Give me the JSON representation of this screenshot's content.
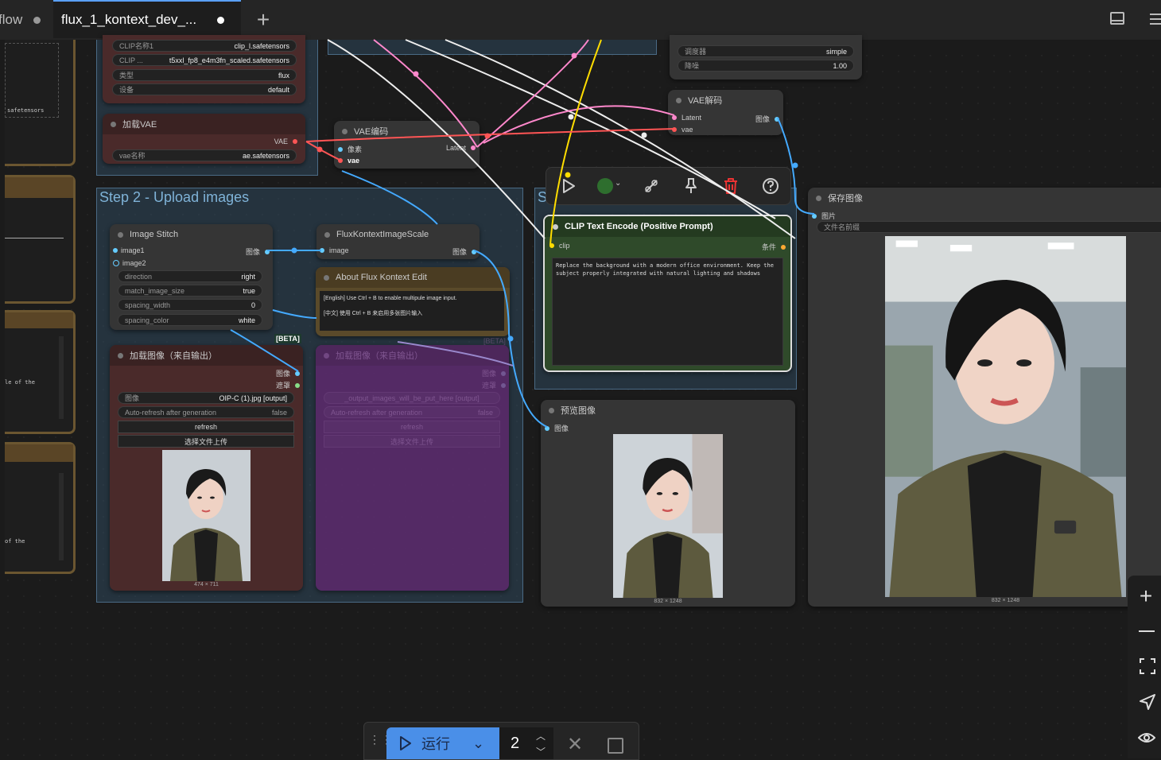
{
  "tabs": [
    {
      "label": "flow"
    },
    {
      "label": "flux_1_kontext_dev_..."
    }
  ],
  "groups": {
    "step2": "Step 2 - Upload images",
    "step3": "S"
  },
  "clip_loader": {
    "w1": {
      "label": "CLIP名称1",
      "value": "clip_l.safetensors"
    },
    "w2": {
      "label": "CLIP ...",
      "value": "t5xxl_fp8_e4m3fn_scaled.safetensors"
    },
    "w3": {
      "label": "类型",
      "value": "flux"
    },
    "w4": {
      "label": "设备",
      "value": "default"
    }
  },
  "vae_loader": {
    "title": "加载VAE",
    "out": "VAE",
    "w_label": "vae名称",
    "w_value": "ae.safetensors"
  },
  "vae_encode": {
    "title": "VAE编码",
    "in1": "像素",
    "in2": "vae",
    "out": "Latent"
  },
  "vae_decode": {
    "title": "VAE解码",
    "in1": "Latent",
    "in2": "vae",
    "out": "图像"
  },
  "sampler": {
    "w1_label": "调度器",
    "w1_value": "simple",
    "w2_label": "降噪",
    "w2_value": "1.00"
  },
  "image_stitch": {
    "title": "Image Stitch",
    "in1": "image1",
    "in2": "image2",
    "out": "图像",
    "w1": {
      "label": "direction",
      "value": "right"
    },
    "w2": {
      "label": "match_image_size",
      "value": "true"
    },
    "w3": {
      "label": "spacing_width",
      "value": "0"
    },
    "w4": {
      "label": "spacing_color",
      "value": "white"
    },
    "badge": "[BETA]"
  },
  "flux_scale": {
    "title": "FluxKontextImageScale",
    "in": "image",
    "out": "图像"
  },
  "about": {
    "title": "About Flux Kontext Edit",
    "line1": "[English] Use Ctrl + B to enable multipule image input.",
    "line2": "[中文] 使用 Ctrl + B 来启用多张图片输入",
    "badge": "[BETA]"
  },
  "load_image1": {
    "title": "加载图像（来自输出）",
    "out1": "图像",
    "out2": "遮罩",
    "w_label": "图像",
    "w_value": "OIP-C (1).jpg [output]",
    "auto_label": "Auto-refresh after generation",
    "auto_value": "false",
    "refresh": "refresh",
    "upload": "选择文件上传",
    "size": "474 × 711"
  },
  "load_image2": {
    "title": "加载图像（来自输出）",
    "out1": "图像",
    "out2": "遮罩",
    "w_value": "_output_images_will_be_put_here [output]",
    "auto_label": "Auto-refresh after generation",
    "auto_value": "false",
    "refresh": "refresh",
    "upload": "选择文件上传"
  },
  "clip_encode": {
    "title": "CLIP Text Encode (Positive Prompt)",
    "in": "clip",
    "out": "条件",
    "text": "Replace the background with a modern office environment. Keep the subject properly integrated with natural lighting and shadows"
  },
  "preview": {
    "title": "预览图像",
    "in": "图像",
    "size": "832 × 1248"
  },
  "save": {
    "title": "保存图像",
    "in": "图片",
    "w_label": "文件名前缀",
    "size": "832 × 1248"
  },
  "left_panel": {
    "a": "safetensors",
    "b": "le of the",
    "c": "of the"
  },
  "run_bar": {
    "run_label": "运行",
    "count": "2"
  },
  "colors": {
    "accent": "#4a8fe8",
    "clip_green": "#2f4a2a",
    "load_red": "#4a2a2a",
    "purple": "#5a2a6a",
    "about_brown": "#5a4a2a"
  },
  "icons": [
    "play-icon",
    "color-dot-icon",
    "bypass-icon",
    "pin-icon",
    "trash-icon",
    "help-icon",
    "zoom-in-icon",
    "zoom-out-icon",
    "fit-icon",
    "send-icon",
    "eye-icon"
  ]
}
